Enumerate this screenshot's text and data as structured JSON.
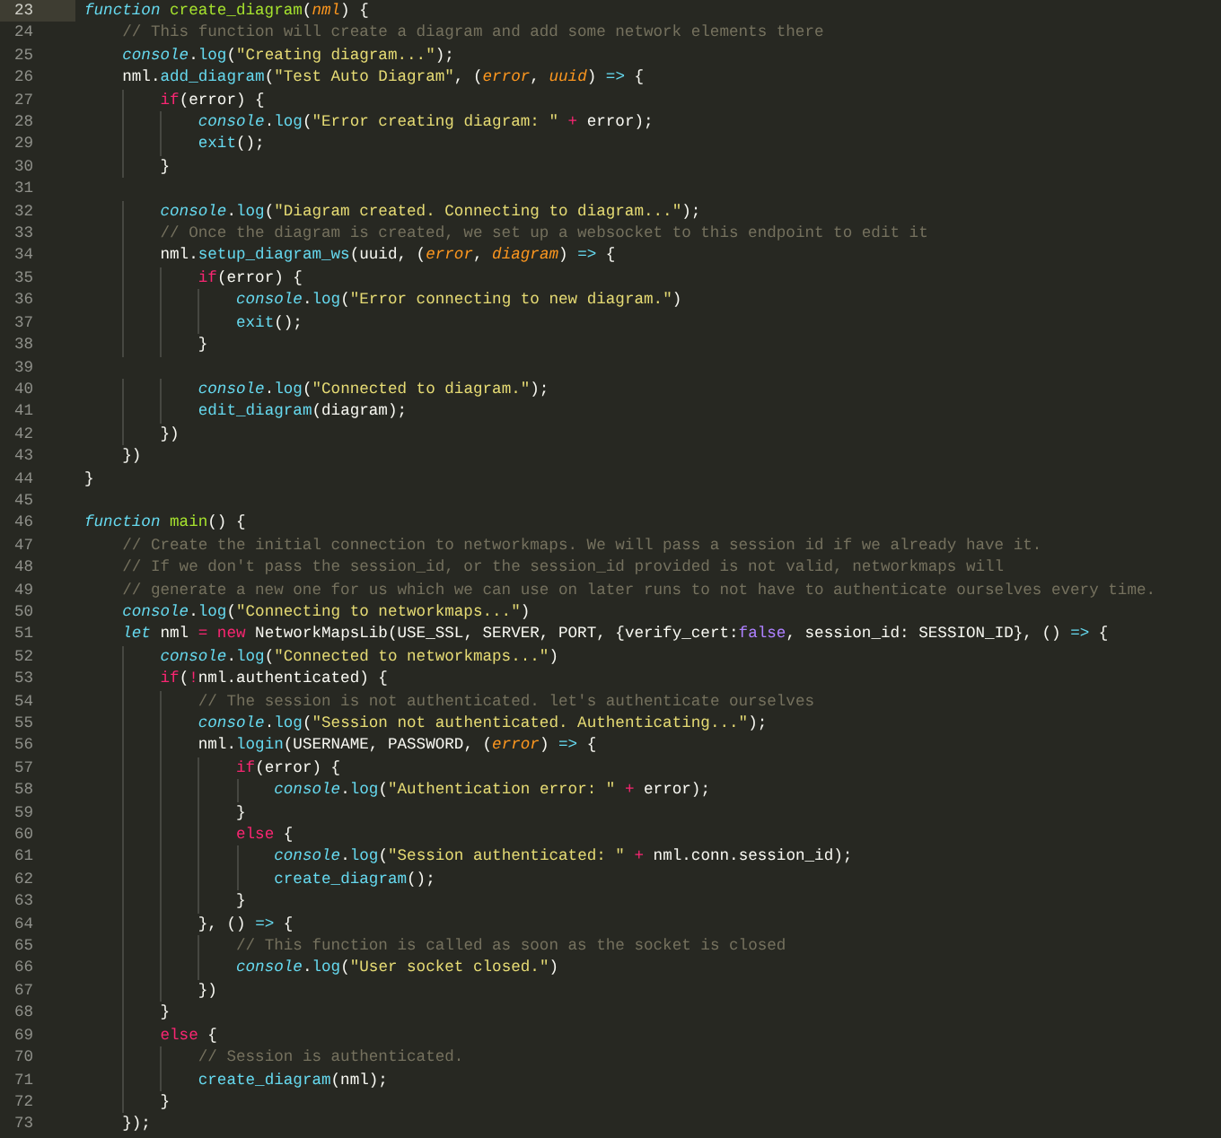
{
  "editor": {
    "lines": [
      {
        "number": "23",
        "selected": true,
        "tokens": [
          {
            "kind": "storage",
            "text": "function"
          },
          {
            "kind": "entity",
            "text": " create_diagram"
          },
          {
            "kind": "plain",
            "text": "("
          },
          {
            "kind": "param",
            "text": "nml"
          },
          {
            "kind": "plain",
            "text": ") {"
          }
        ]
      },
      {
        "number": "24",
        "selected": false,
        "tokens": [
          {
            "kind": "comment",
            "text": "    // This function will create a diagram and add some network elements there"
          }
        ]
      },
      {
        "number": "25",
        "selected": false,
        "tokens": [
          {
            "kind": "storage",
            "text": "    console"
          },
          {
            "kind": "plain",
            "text": "."
          },
          {
            "kind": "support",
            "text": "log"
          },
          {
            "kind": "plain",
            "text": "("
          },
          {
            "kind": "string",
            "text": "\"Creating diagram...\""
          },
          {
            "kind": "plain",
            "text": ");"
          }
        ]
      },
      {
        "number": "26",
        "selected": false,
        "tokens": [
          {
            "kind": "plain",
            "text": "    nml."
          },
          {
            "kind": "support",
            "text": "add_diagram"
          },
          {
            "kind": "plain",
            "text": "("
          },
          {
            "kind": "string",
            "text": "\"Test Auto Diagram\""
          },
          {
            "kind": "plain",
            "text": ", ("
          },
          {
            "kind": "param",
            "text": "error"
          },
          {
            "kind": "plain",
            "text": ", "
          },
          {
            "kind": "param",
            "text": "uuid"
          },
          {
            "kind": "plain",
            "text": ") "
          },
          {
            "kind": "support",
            "text": "=>"
          },
          {
            "kind": "plain",
            "text": " {"
          }
        ]
      },
      {
        "number": "27",
        "selected": false,
        "tokens": [
          {
            "kind": "keyword",
            "text": "        if"
          },
          {
            "kind": "plain",
            "text": "(error) {"
          }
        ]
      },
      {
        "number": "28",
        "selected": false,
        "tokens": [
          {
            "kind": "storage",
            "text": "            console"
          },
          {
            "kind": "plain",
            "text": "."
          },
          {
            "kind": "support",
            "text": "log"
          },
          {
            "kind": "plain",
            "text": "("
          },
          {
            "kind": "string",
            "text": "\"Error creating diagram: \""
          },
          {
            "kind": "keyword",
            "text": " +"
          },
          {
            "kind": "plain",
            "text": " error);"
          }
        ]
      },
      {
        "number": "29",
        "selected": false,
        "tokens": [
          {
            "kind": "support",
            "text": "            exit"
          },
          {
            "kind": "plain",
            "text": "();"
          }
        ]
      },
      {
        "number": "30",
        "selected": false,
        "tokens": [
          {
            "kind": "plain",
            "text": "        }"
          }
        ]
      },
      {
        "number": "31",
        "selected": false
      },
      {
        "number": "32",
        "selected": false,
        "tokens": [
          {
            "kind": "storage",
            "text": "        console"
          },
          {
            "kind": "plain",
            "text": "."
          },
          {
            "kind": "support",
            "text": "log"
          },
          {
            "kind": "plain",
            "text": "("
          },
          {
            "kind": "string",
            "text": "\"Diagram created. Connecting to diagram...\""
          },
          {
            "kind": "plain",
            "text": ");"
          }
        ]
      },
      {
        "number": "33",
        "selected": false,
        "tokens": [
          {
            "kind": "comment",
            "text": "        // Once the diagram is created, we set up a websocket to this endpoint to edit it"
          }
        ]
      },
      {
        "number": "34",
        "selected": false,
        "tokens": [
          {
            "kind": "plain",
            "text": "        nml."
          },
          {
            "kind": "support",
            "text": "setup_diagram_ws"
          },
          {
            "kind": "plain",
            "text": "(uuid, ("
          },
          {
            "kind": "param",
            "text": "error"
          },
          {
            "kind": "plain",
            "text": ", "
          },
          {
            "kind": "param",
            "text": "diagram"
          },
          {
            "kind": "plain",
            "text": ") "
          },
          {
            "kind": "support",
            "text": "=>"
          },
          {
            "kind": "plain",
            "text": " {"
          }
        ]
      },
      {
        "number": "35",
        "selected": false,
        "tokens": [
          {
            "kind": "keyword",
            "text": "            if"
          },
          {
            "kind": "plain",
            "text": "(error) {"
          }
        ]
      },
      {
        "number": "36",
        "selected": false,
        "tokens": [
          {
            "kind": "storage",
            "text": "                console"
          },
          {
            "kind": "plain",
            "text": "."
          },
          {
            "kind": "support",
            "text": "log"
          },
          {
            "kind": "plain",
            "text": "("
          },
          {
            "kind": "string",
            "text": "\"Error connecting to new diagram.\""
          },
          {
            "kind": "plain",
            "text": ")"
          }
        ]
      },
      {
        "number": "37",
        "selected": false,
        "tokens": [
          {
            "kind": "support",
            "text": "                exit"
          },
          {
            "kind": "plain",
            "text": "();"
          }
        ]
      },
      {
        "number": "38",
        "selected": false,
        "tokens": [
          {
            "kind": "plain",
            "text": "            }"
          }
        ]
      },
      {
        "number": "39",
        "selected": false
      },
      {
        "number": "40",
        "selected": false,
        "tokens": [
          {
            "kind": "storage",
            "text": "            console"
          },
          {
            "kind": "plain",
            "text": "."
          },
          {
            "kind": "support",
            "text": "log"
          },
          {
            "kind": "plain",
            "text": "("
          },
          {
            "kind": "string",
            "text": "\"Connected to diagram.\""
          },
          {
            "kind": "plain",
            "text": ");"
          }
        ]
      },
      {
        "number": "41",
        "selected": false,
        "tokens": [
          {
            "kind": "support",
            "text": "            edit_diagram"
          },
          {
            "kind": "plain",
            "text": "(diagram);"
          }
        ]
      },
      {
        "number": "42",
        "selected": false,
        "tokens": [
          {
            "kind": "plain",
            "text": "        })"
          }
        ]
      },
      {
        "number": "43",
        "selected": false,
        "tokens": [
          {
            "kind": "plain",
            "text": "    })"
          }
        ]
      },
      {
        "number": "44",
        "selected": false,
        "tokens": [
          {
            "kind": "plain",
            "text": "}"
          }
        ]
      },
      {
        "number": "45",
        "selected": false
      },
      {
        "number": "46",
        "selected": false,
        "tokens": [
          {
            "kind": "storage",
            "text": "function"
          },
          {
            "kind": "entity",
            "text": " main"
          },
          {
            "kind": "plain",
            "text": "() {"
          }
        ]
      },
      {
        "number": "47",
        "selected": false,
        "tokens": [
          {
            "kind": "comment",
            "text": "    // Create the initial connection to networkmaps. We will pass a session id if we already have it."
          }
        ]
      },
      {
        "number": "48",
        "selected": false,
        "tokens": [
          {
            "kind": "comment",
            "text": "    // If we don't pass the session_id, or the session_id provided is not valid, networkmaps will"
          }
        ]
      },
      {
        "number": "49",
        "selected": false,
        "tokens": [
          {
            "kind": "comment",
            "text": "    // generate a new one for us which we can use on later runs to not have to authenticate ourselves every time."
          }
        ]
      },
      {
        "number": "50",
        "selected": false,
        "tokens": [
          {
            "kind": "storage",
            "text": "    console"
          },
          {
            "kind": "plain",
            "text": "."
          },
          {
            "kind": "support",
            "text": "log"
          },
          {
            "kind": "plain",
            "text": "("
          },
          {
            "kind": "string",
            "text": "\"Connecting to networkmaps...\""
          },
          {
            "kind": "plain",
            "text": ")"
          }
        ]
      },
      {
        "number": "51",
        "selected": false,
        "tokens": [
          {
            "kind": "storage",
            "text": "    let"
          },
          {
            "kind": "plain",
            "text": " nml "
          },
          {
            "kind": "keyword",
            "text": "="
          },
          {
            "kind": "keyword",
            "text": " new"
          },
          {
            "kind": "plain",
            "text": " NetworkMapsLib(USE_SSL, SERVER, PORT, {verify_cert:"
          },
          {
            "kind": "constant",
            "text": "false"
          },
          {
            "kind": "plain",
            "text": ", session_id: SESSION_ID}, () "
          },
          {
            "kind": "support",
            "text": "=>"
          },
          {
            "kind": "plain",
            "text": " {"
          }
        ]
      },
      {
        "number": "52",
        "selected": false,
        "tokens": [
          {
            "kind": "storage",
            "text": "        console"
          },
          {
            "kind": "plain",
            "text": "."
          },
          {
            "kind": "support",
            "text": "log"
          },
          {
            "kind": "plain",
            "text": "("
          },
          {
            "kind": "string",
            "text": "\"Connected to networkmaps...\""
          },
          {
            "kind": "plain",
            "text": ")"
          }
        ]
      },
      {
        "number": "53",
        "selected": false,
        "tokens": [
          {
            "kind": "keyword",
            "text": "        if"
          },
          {
            "kind": "plain",
            "text": "("
          },
          {
            "kind": "keyword",
            "text": "!"
          },
          {
            "kind": "plain",
            "text": "nml.authenticated) {"
          }
        ]
      },
      {
        "number": "54",
        "selected": false,
        "tokens": [
          {
            "kind": "comment",
            "text": "            // The session is not authenticated. let's authenticate ourselves"
          }
        ]
      },
      {
        "number": "55",
        "selected": false,
        "tokens": [
          {
            "kind": "storage",
            "text": "            console"
          },
          {
            "kind": "plain",
            "text": "."
          },
          {
            "kind": "support",
            "text": "log"
          },
          {
            "kind": "plain",
            "text": "("
          },
          {
            "kind": "string",
            "text": "\"Session not authenticated. Authenticating...\""
          },
          {
            "kind": "plain",
            "text": ");"
          }
        ]
      },
      {
        "number": "56",
        "selected": false,
        "tokens": [
          {
            "kind": "plain",
            "text": "            nml."
          },
          {
            "kind": "support",
            "text": "login"
          },
          {
            "kind": "plain",
            "text": "(USERNAME, PASSWORD, ("
          },
          {
            "kind": "param",
            "text": "error"
          },
          {
            "kind": "plain",
            "text": ") "
          },
          {
            "kind": "support",
            "text": "=>"
          },
          {
            "kind": "plain",
            "text": " {"
          }
        ]
      },
      {
        "number": "57",
        "selected": false,
        "tokens": [
          {
            "kind": "keyword",
            "text": "                if"
          },
          {
            "kind": "plain",
            "text": "(error) {"
          }
        ]
      },
      {
        "number": "58",
        "selected": false,
        "tokens": [
          {
            "kind": "storage",
            "text": "                    console"
          },
          {
            "kind": "plain",
            "text": "."
          },
          {
            "kind": "support",
            "text": "log"
          },
          {
            "kind": "plain",
            "text": "("
          },
          {
            "kind": "string",
            "text": "\"Authentication error: \""
          },
          {
            "kind": "keyword",
            "text": " +"
          },
          {
            "kind": "plain",
            "text": " error);"
          }
        ]
      },
      {
        "number": "59",
        "selected": false,
        "tokens": [
          {
            "kind": "plain",
            "text": "                }"
          }
        ]
      },
      {
        "number": "60",
        "selected": false,
        "tokens": [
          {
            "kind": "keyword",
            "text": "                else"
          },
          {
            "kind": "plain",
            "text": " {"
          }
        ]
      },
      {
        "number": "61",
        "selected": false,
        "tokens": [
          {
            "kind": "storage",
            "text": "                    console"
          },
          {
            "kind": "plain",
            "text": "."
          },
          {
            "kind": "support",
            "text": "log"
          },
          {
            "kind": "plain",
            "text": "("
          },
          {
            "kind": "string",
            "text": "\"Session authenticated: \""
          },
          {
            "kind": "keyword",
            "text": " +"
          },
          {
            "kind": "plain",
            "text": " nml.conn.session_id);"
          }
        ]
      },
      {
        "number": "62",
        "selected": false,
        "tokens": [
          {
            "kind": "support",
            "text": "                    create_diagram"
          },
          {
            "kind": "plain",
            "text": "();"
          }
        ]
      },
      {
        "number": "63",
        "selected": false,
        "tokens": [
          {
            "kind": "plain",
            "text": "                }"
          }
        ]
      },
      {
        "number": "64",
        "selected": false,
        "tokens": [
          {
            "kind": "plain",
            "text": "            }, () "
          },
          {
            "kind": "support",
            "text": "=>"
          },
          {
            "kind": "plain",
            "text": " {"
          }
        ]
      },
      {
        "number": "65",
        "selected": false,
        "tokens": [
          {
            "kind": "comment",
            "text": "                // This function is called as soon as the socket is closed"
          }
        ]
      },
      {
        "number": "66",
        "selected": false,
        "tokens": [
          {
            "kind": "storage",
            "text": "                console"
          },
          {
            "kind": "plain",
            "text": "."
          },
          {
            "kind": "support",
            "text": "log"
          },
          {
            "kind": "plain",
            "text": "("
          },
          {
            "kind": "string",
            "text": "\"User socket closed.\""
          },
          {
            "kind": "plain",
            "text": ")"
          }
        ]
      },
      {
        "number": "67",
        "selected": false,
        "tokens": [
          {
            "kind": "plain",
            "text": "            })"
          }
        ]
      },
      {
        "number": "68",
        "selected": false,
        "tokens": [
          {
            "kind": "plain",
            "text": "        }"
          }
        ]
      },
      {
        "number": "69",
        "selected": false,
        "tokens": [
          {
            "kind": "keyword",
            "text": "        else"
          },
          {
            "kind": "plain",
            "text": " {"
          }
        ]
      },
      {
        "number": "70",
        "selected": false,
        "tokens": [
          {
            "kind": "comment",
            "text": "            // Session is authenticated."
          }
        ]
      },
      {
        "number": "71",
        "selected": false,
        "tokens": [
          {
            "kind": "support",
            "text": "            create_diagram"
          },
          {
            "kind": "plain",
            "text": "(nml);"
          }
        ]
      },
      {
        "number": "72",
        "selected": false,
        "tokens": [
          {
            "kind": "plain",
            "text": "        }"
          }
        ]
      },
      {
        "number": "73",
        "selected": false,
        "tokens": [
          {
            "kind": "plain",
            "text": "    });"
          }
        ]
      }
    ]
  }
}
